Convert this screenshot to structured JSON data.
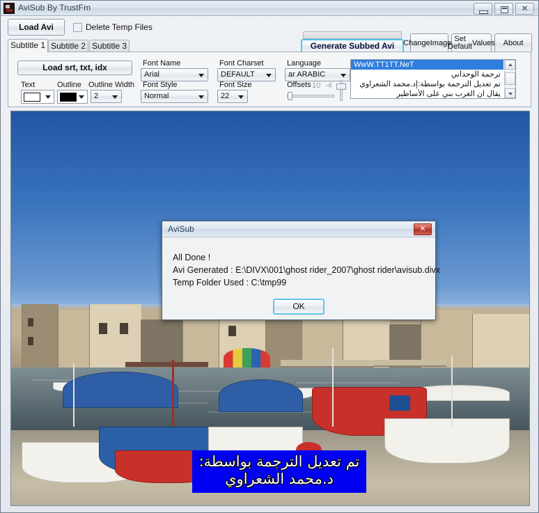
{
  "window": {
    "title": "AviSub By TrustFm",
    "icon": "app-icon",
    "controls": {
      "minimize": "–",
      "maximize": "□",
      "close": "✕"
    }
  },
  "toolbar": {
    "load_avi_label": "Load Avi",
    "delete_temp_label": "Delete Temp Files",
    "delete_temp_checked": false,
    "generate_label": "Generate Subbed Avi",
    "progress_value": 0,
    "change_images_line1": "Change",
    "change_images_line2": "Images",
    "set_default_line1": "Set Default",
    "set_default_line2": "Values",
    "about_label": "About"
  },
  "tabs": [
    {
      "label": "Subtitle 1",
      "active": true
    },
    {
      "label": "Subtitle 2",
      "active": false
    },
    {
      "label": "Subtitle 3",
      "active": false
    }
  ],
  "panel": {
    "load_srt_label": "Load srt, txt, idx",
    "font_name_label": "Font Name",
    "font_name_value": "Arial",
    "font_charset_label": "Font Charset",
    "font_charset_value": "DEFAULT",
    "language_label": "Language",
    "language_value": "ar ARABIC",
    "text_color_label": "Text",
    "text_color_value": "#ffffff",
    "outline_color_label": "Outline",
    "outline_color_value": "#000000",
    "outline_width_label": "Outline Width",
    "outline_width_value": "2",
    "font_style_label": "Font Style",
    "font_style_value": "Normal",
    "font_size_label": "Font Size",
    "font_size_value": "22",
    "offsets_label": "Offsets",
    "offset_x": "10",
    "offset_y": "-4"
  },
  "subtitle_list": [
    {
      "text": "WwW.TT1TT.NeT",
      "selected": true
    },
    {
      "text": "ترجمة الوحداني",
      "selected": false
    },
    {
      "text": "تم تعديل الترجمة بواسطة:إد.محمد الشعراوي",
      "selected": false
    },
    {
      "text": "يقال ان الغرب بني على الأساطير",
      "selected": false
    }
  ],
  "video": {
    "subtitle_line1": "تم تعديل الترجمة بواسطة:",
    "subtitle_line2": "د.محمد الشعراوي",
    "subtitle_bg_color": "#0000f2",
    "subtitle_text_color": "#ffffff"
  },
  "dialog": {
    "title": "AviSub",
    "close_label": "✕",
    "line1": "All Done !",
    "line2": "Avi Generated : E:\\DIVX\\001\\ghost rider_2007\\ghost rider\\avisub.divx",
    "line3": "Temp Folder Used : C:\\tmp99",
    "ok_label": "OK"
  }
}
